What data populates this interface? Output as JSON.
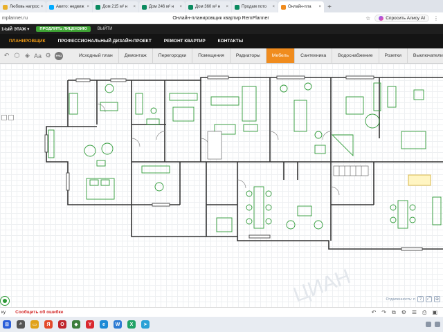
{
  "browser": {
    "tabs": [
      {
        "label": "Любовь напрос",
        "color": "#e9b02b"
      },
      {
        "label": "Авито: недвиж",
        "color": "#00aaff"
      },
      {
        "label": "Дом 215 м² н",
        "color": "#0a8a5f"
      },
      {
        "label": "Дом 246 м² н",
        "color": "#0a8a5f"
      },
      {
        "label": "Дом 360 м² н",
        "color": "#0a8a5f"
      },
      {
        "label": "Продам пото",
        "color": "#0a8a5f"
      },
      {
        "label": "Онлайн-пла",
        "color": "#f08c1e"
      }
    ],
    "url": "mplanner.ru",
    "page_title": "Онлайн-планировщик квартир RemPlanner",
    "alisa_label": "Спросить Алису AI"
  },
  "app": {
    "floor_selector": "1-ЫЙ ЭТАЖ",
    "license_button": "ПРОДЛИТЬ ЛИЦЕНЗИЮ",
    "exit_label": "ВЫЙТИ",
    "nav": [
      {
        "label": "ПЛАНИРОВЩИК",
        "active": true
      },
      {
        "label": "ПРОФЕССИОНАЛЬНЫЙ ДИЗАЙН-ПРОЕКТ",
        "active": false
      },
      {
        "label": "РЕМОНТ КВАРТИР",
        "active": false
      },
      {
        "label": "КОНТАКТЫ",
        "active": false
      }
    ],
    "tools": [
      "undo-icon",
      "cube-icon",
      "layers-icon",
      "text-icon",
      "settings-icon",
      "pro-icon"
    ],
    "pro_label": "PRO",
    "stages": [
      {
        "label": "Исходный план",
        "active": false
      },
      {
        "label": "Демонтаж",
        "active": false
      },
      {
        "label": "Перегородки",
        "active": false
      },
      {
        "label": "Помещения",
        "active": false
      },
      {
        "label": "Радиаторы",
        "active": false
      },
      {
        "label": "Мебель",
        "active": true
      },
      {
        "label": "Сантехника",
        "active": false
      },
      {
        "label": "Водоснабжение",
        "active": false
      },
      {
        "label": "Розетки",
        "active": false
      },
      {
        "label": "Выключатели",
        "active": false
      }
    ],
    "canvas_hint": "Отдаленность: п",
    "status_left": "ку",
    "report_error": "Сообщить об ошибке"
  },
  "colors": {
    "accent": "#f08c1e",
    "license": "#3fa535",
    "error": "#d32b2b",
    "furniture": "#2d9a36",
    "wall": "#333333"
  }
}
